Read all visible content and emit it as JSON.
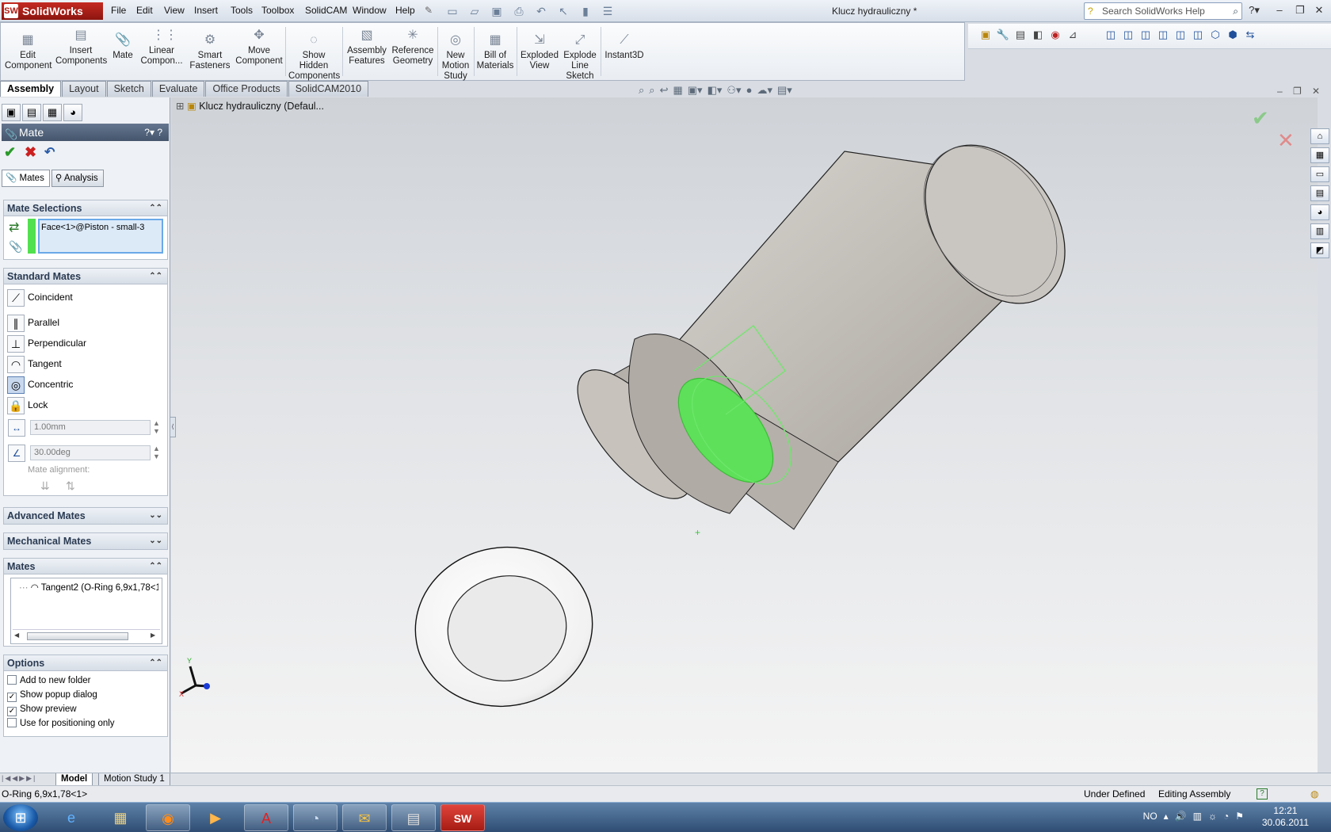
{
  "app": {
    "logo": "SolidWorks",
    "menu": [
      "File",
      "Edit",
      "View",
      "Insert",
      "Tools",
      "Toolbox",
      "SolidCAM",
      "Window",
      "Help"
    ],
    "document_title": "Klucz hydrauliczny *",
    "search_placeholder": "Search SolidWorks Help"
  },
  "command_manager": [
    {
      "label": "Edit\nComponent"
    },
    {
      "label": "Insert\nComponents"
    },
    {
      "label": "Mate"
    },
    {
      "label": "Linear\nCompon..."
    },
    {
      "label": "Smart\nFasteners"
    },
    {
      "label": "Move\nComponent"
    },
    {
      "label": "Show\nHidden\nComponents"
    },
    {
      "label": "Assembly\nFeatures"
    },
    {
      "label": "Reference\nGeometry"
    },
    {
      "label": "New\nMotion\nStudy"
    },
    {
      "label": "Bill of\nMaterials"
    },
    {
      "label": "Exploded\nView"
    },
    {
      "label": "Explode\nLine\nSketch"
    },
    {
      "label": "Instant3D"
    }
  ],
  "tabs": [
    "Assembly",
    "Layout",
    "Sketch",
    "Evaluate",
    "Office Products",
    "SolidCAM2010"
  ],
  "property_manager": {
    "title": "Mate",
    "subtabs": [
      "Mates",
      "Analysis"
    ],
    "mate_selections": {
      "header": "Mate Selections",
      "selection": "Face<1>@Piston - small-3"
    },
    "standard_mates": {
      "header": "Standard Mates",
      "items": [
        "Coincident",
        "Parallel",
        "Perpendicular",
        "Tangent",
        "Concentric",
        "Lock"
      ],
      "selected": "Concentric",
      "distance": "1.00mm",
      "angle": "30.00deg",
      "alignment_label": "Mate alignment:"
    },
    "advanced_mates": "Advanced Mates",
    "mechanical_mates": "Mechanical Mates",
    "mates": {
      "header": "Mates",
      "items": [
        "Tangent2 (O-Ring 6,9x1,78<1"
      ]
    },
    "options": {
      "header": "Options",
      "items": [
        {
          "label": "Add to new folder",
          "checked": false
        },
        {
          "label": "Show popup dialog",
          "checked": true
        },
        {
          "label": "Show preview",
          "checked": true
        },
        {
          "label": "Use for positioning only",
          "checked": false
        }
      ]
    }
  },
  "viewport": {
    "tree_root": "Klucz hydrauliczny  (Defaul...",
    "triad_labels": {
      "x": "X",
      "y": "Y"
    }
  },
  "bottom_tabs": [
    "Model",
    "Motion Study 1"
  ],
  "status": {
    "left": "O-Ring 6,9x1,78<1>",
    "definition": "Under Defined",
    "mode": "Editing Assembly"
  },
  "taskbar": {
    "language": "NO",
    "time": "12:21",
    "date": "30.06.2011"
  }
}
